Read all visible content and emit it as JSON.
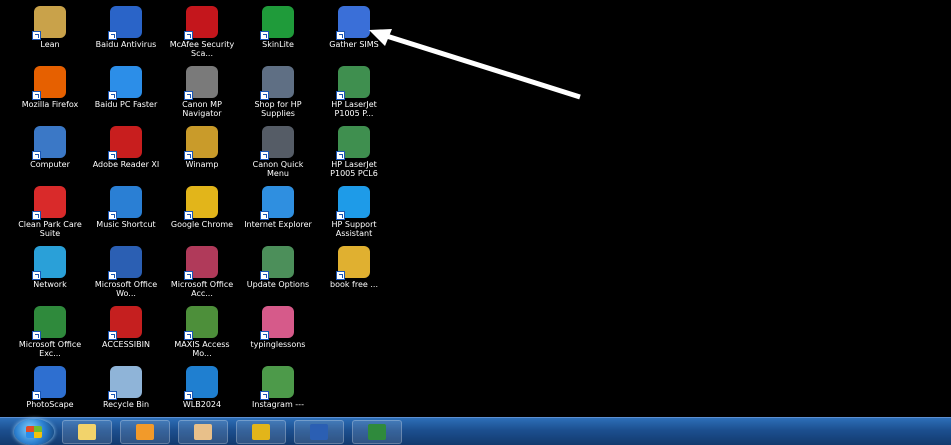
{
  "desktop": {
    "icons": [
      {
        "label": "Lean",
        "name": "folder-icon",
        "color": "#c9a24a"
      },
      {
        "label": "Baidu Antivirus",
        "name": "baidu-antivirus-icon",
        "color": "#2a64c8"
      },
      {
        "label": "McAfee Security Sca...",
        "name": "mcafee-icon",
        "color": "#c4161c"
      },
      {
        "label": "SkinLite",
        "name": "skinlite-icon",
        "color": "#1f9b3a"
      },
      {
        "label": "Gather SIMS",
        "name": "gather-sims-icon",
        "color": "#3a6fd8"
      },
      {
        "label": "Mozilla Firefox",
        "name": "firefox-icon",
        "color": "#e66000"
      },
      {
        "label": "Baidu PC Faster",
        "name": "baidu-pc-faster-icon",
        "color": "#2c8ee8"
      },
      {
        "label": "Canon MP Navigator",
        "name": "canon-mp-navigator-icon",
        "color": "#7a7a7a"
      },
      {
        "label": "Shop for HP Supplies",
        "name": "hp-supplies-icon",
        "color": "#5f6f84"
      },
      {
        "label": "HP LaserJet P1005 P...",
        "name": "hp-laserjet-icon",
        "color": "#3f8f4f"
      },
      {
        "label": "Computer",
        "name": "computer-icon",
        "color": "#3b78c6"
      },
      {
        "label": "Adobe Reader XI",
        "name": "adobe-reader-icon",
        "color": "#c81e1e"
      },
      {
        "label": "Winamp",
        "name": "winamp-icon",
        "color": "#c99b2a"
      },
      {
        "label": "Canon Quick Menu",
        "name": "canon-quick-menu-icon",
        "color": "#555c66"
      },
      {
        "label": "HP LaserJet P1005 PCL6",
        "name": "hp-laserjet-pcl6-icon",
        "color": "#3f8f4f"
      },
      {
        "label": "Clean Park Care Suite",
        "name": "cleaner-icon",
        "color": "#d92a2a"
      },
      {
        "label": "Music Shortcut",
        "name": "music-icon",
        "color": "#2a7fd4"
      },
      {
        "label": "Google Chrome",
        "name": "chrome-icon",
        "color": "#e2b51a"
      },
      {
        "label": "Internet Explorer",
        "name": "internet-explorer-icon",
        "color": "#2f8fe0"
      },
      {
        "label": "HP Support Assistant",
        "name": "hp-support-icon",
        "color": "#1e9be8"
      },
      {
        "label": "Network",
        "name": "network-icon",
        "color": "#2aa0d8"
      },
      {
        "label": "Microsoft Office Wo...",
        "name": "word-icon",
        "color": "#2b5fb3"
      },
      {
        "label": "Microsoft Office Acc...",
        "name": "access-icon",
        "color": "#b03a5a"
      },
      {
        "label": "Update Options",
        "name": "update-icon",
        "color": "#4c8f5a"
      },
      {
        "label": "book free ...",
        "name": "book-icon",
        "color": "#e0b030"
      },
      {
        "label": "Microsoft Office Exc...",
        "name": "excel-icon",
        "color": "#2f8a3c"
      },
      {
        "label": "ACCESSIBIN",
        "name": "accessibin-icon",
        "color": "#c51f1f"
      },
      {
        "label": "MAXIS Access Mo...",
        "name": "maxis-icon",
        "color": "#4d8f3a"
      },
      {
        "label": "typinglessons",
        "name": "typing-icon",
        "color": "#d65a8a"
      },
      {
        "label": "",
        "name": "empty-slot",
        "color": ""
      },
      {
        "label": "PhotoScape",
        "name": "photoscape-icon",
        "color": "#2e6fd0"
      },
      {
        "label": "Recycle Bin",
        "name": "recycle-bin-icon",
        "color": "#8fb4d8"
      },
      {
        "label": "WLB2024",
        "name": "wlb-icon",
        "color": "#1f7fd0"
      },
      {
        "label": "Instagram ---",
        "name": "instagram-icon",
        "color": "#4d9a4a"
      },
      {
        "label": "",
        "name": "empty-slot",
        "color": ""
      }
    ]
  },
  "taskbar": {
    "items": [
      {
        "name": "taskbar-explorer",
        "color": "#f2d36b"
      },
      {
        "name": "taskbar-media-player",
        "color": "#f29a2a"
      },
      {
        "name": "taskbar-paint",
        "color": "#e8c08a"
      },
      {
        "name": "taskbar-chrome",
        "color": "#e2b51a"
      },
      {
        "name": "taskbar-word",
        "color": "#2b5fb3"
      },
      {
        "name": "taskbar-excel",
        "color": "#2f8a3c"
      }
    ]
  }
}
